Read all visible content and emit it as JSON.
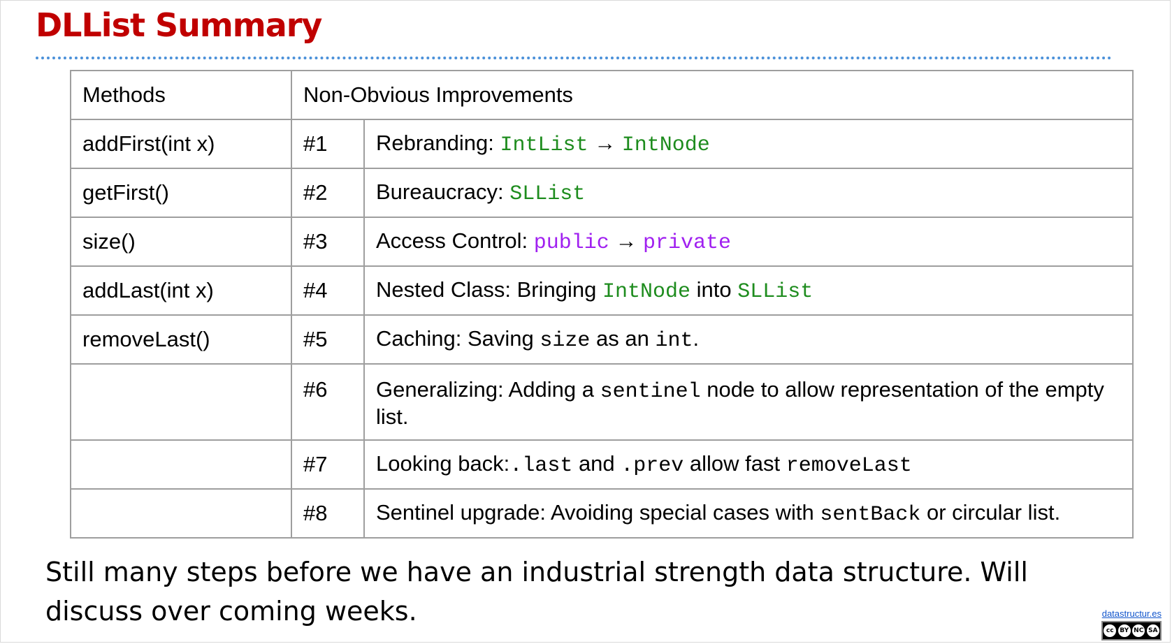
{
  "slide": {
    "title": "DLList Summary",
    "table": {
      "headers": [
        "Methods",
        "Non-Obvious Improvements"
      ],
      "methods": [
        "addFirst(int x)",
        "getFirst()",
        "size()",
        "addLast(int x)",
        "removeLast()",
        "",
        "",
        ""
      ],
      "improvements": [
        {
          "num": "#1",
          "parts": [
            {
              "t": "Rebranding: "
            },
            {
              "t": "IntList",
              "code": true,
              "color": "green"
            },
            {
              "t": " → "
            },
            {
              "t": "IntNode",
              "code": true,
              "color": "green"
            }
          ]
        },
        {
          "num": "#2",
          "parts": [
            {
              "t": "Bureaucracy: "
            },
            {
              "t": "SLList",
              "code": true,
              "color": "green"
            }
          ]
        },
        {
          "num": "#3",
          "parts": [
            {
              "t": "Access Control: "
            },
            {
              "t": "public",
              "code": true,
              "color": "purple"
            },
            {
              "t": " → "
            },
            {
              "t": "private",
              "code": true,
              "color": "purple"
            }
          ]
        },
        {
          "num": "#4",
          "parts": [
            {
              "t": "Nested Class: Bringing "
            },
            {
              "t": "IntNode",
              "code": true,
              "color": "green"
            },
            {
              "t": " into "
            },
            {
              "t": "SLList",
              "code": true,
              "color": "green"
            }
          ]
        },
        {
          "num": "#5",
          "parts": [
            {
              "t": "Caching: Saving "
            },
            {
              "t": "size",
              "code": true
            },
            {
              "t": " as an "
            },
            {
              "t": "int",
              "code": true
            },
            {
              "t": "."
            }
          ]
        },
        {
          "num": "#6",
          "parts": [
            {
              "t": "Generalizing: Adding a "
            },
            {
              "t": "sentinel",
              "code": true
            },
            {
              "t": " node to allow representation of the empty list."
            }
          ]
        },
        {
          "num": "#7",
          "parts": [
            {
              "t": "Looking back:"
            },
            {
              "t": ".last",
              "code": true
            },
            {
              "t": " and "
            },
            {
              "t": ".prev",
              "code": true
            },
            {
              "t": " allow fast "
            },
            {
              "t": "removeLast",
              "code": true
            }
          ]
        },
        {
          "num": "#8",
          "parts": [
            {
              "t": "Sentinel upgrade: Avoiding special cases with "
            },
            {
              "t": "sentBack",
              "code": true
            },
            {
              "t": " or circular list."
            }
          ]
        }
      ]
    },
    "footer_text": "Still many steps before we have an industrial strength data structure. Will discuss over coming weeks.",
    "site_link": "datastructur.es",
    "license_badge": [
      "cc",
      "BY",
      "NC",
      "SA"
    ],
    "colors": {
      "title": "#c00000",
      "code_green": "#1e8c1e",
      "code_purple": "#a020f0",
      "link": "#1155cc"
    }
  }
}
